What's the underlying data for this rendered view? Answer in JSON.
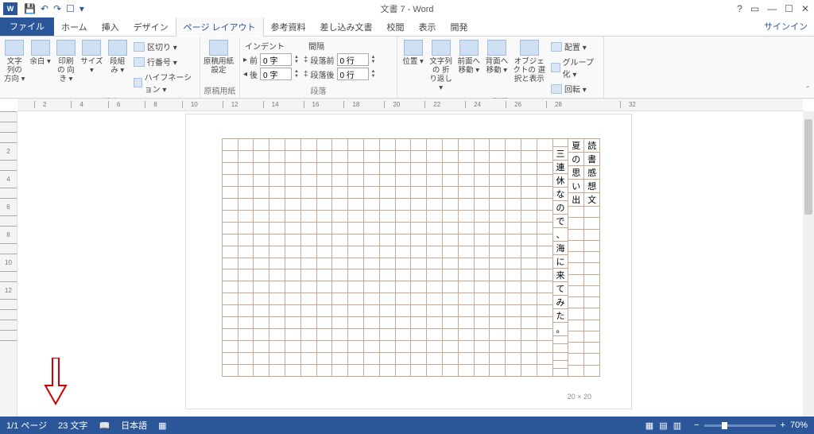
{
  "title": "文書 7 - Word",
  "qat": {
    "save": "💾",
    "undo": "↶",
    "redo": "↷",
    "touch": "☐"
  },
  "signin": "サインイン",
  "tabs": {
    "file": "ファイル",
    "home": "ホーム",
    "insert": "挿入",
    "design": "デザイン",
    "layout": "ページ レイアウト",
    "ref": "参考資料",
    "mail": "差し込み文書",
    "review": "校閲",
    "view": "表示",
    "dev": "開発"
  },
  "ribbon": {
    "pageSetup": {
      "label": "ページ設定",
      "textDir": "文字列の\n方向 ▾",
      "margins": "余白\n▾",
      "orient": "印刷の\n向き ▾",
      "size": "サイズ\n▾",
      "cols": "段組み\n▾",
      "breaks": "区切り ▾",
      "lineNum": "行番号 ▾",
      "hyph": "ハイフネーション ▾"
    },
    "genkou": {
      "label": "原稿用紙",
      "btn": "原稿用紙\n設定"
    },
    "para": {
      "label": "段落",
      "indent": "インデント",
      "spacing": "間隔",
      "before": "前",
      "after": "後",
      "val0": "0 字",
      "spBefore": "段落前",
      "spAfter": "段落後",
      "sp0": "0 行"
    },
    "arrange": {
      "label": "配置",
      "pos": "位置\n▾",
      "wrap": "文字列の\n折り返し ▾",
      "fwd": "前面へ\n移動 ▾",
      "back": "背面へ\n移動 ▾",
      "pane": "オブジェクトの\n選択と表示",
      "align": "配置 ▾",
      "group": "グループ化 ▾",
      "rotate": "回転 ▾"
    }
  },
  "doc": {
    "gridSize": "20 × 20",
    "col1": [
      "読",
      "書",
      "感",
      "想",
      "文",
      "",
      "",
      "",
      "",
      "",
      "",
      "",
      "",
      "",
      "",
      "",
      "",
      "",
      "",
      ""
    ],
    "col2": [
      "夏",
      "の",
      "思",
      "い",
      "出",
      "",
      "",
      "",
      "",
      "",
      "",
      "",
      "",
      "",
      "",
      "",
      "",
      "",
      "",
      ""
    ],
    "col3": [
      "",
      "三",
      "連",
      "休",
      "な",
      "の",
      "で",
      "、",
      "海",
      "に",
      "来",
      "て",
      "み",
      "た",
      "。",
      "",
      "",
      "",
      "",
      ""
    ]
  },
  "status": {
    "page": "1/1 ページ",
    "words": "23 文字",
    "lang": "日本語",
    "zoom": "70%"
  },
  "rulerH": [
    "",
    "2",
    "",
    "4",
    "",
    "6",
    "",
    "8",
    "",
    "10",
    "",
    "12",
    "",
    "14",
    "",
    "16",
    "",
    "18",
    "",
    "20",
    "",
    "22",
    "",
    "24",
    "",
    "26",
    "",
    "28",
    "",
    "",
    "",
    "32",
    ""
  ],
  "rulerV": [
    "",
    "",
    "",
    "2",
    "",
    "4",
    "",
    "6",
    "",
    "8",
    "",
    "10",
    "",
    "12",
    "",
    "",
    "",
    "",
    ""
  ]
}
